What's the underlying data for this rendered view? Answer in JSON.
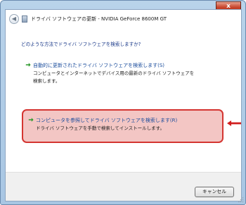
{
  "window": {
    "title": "ドライバ ソフトウェアの更新 - NVIDIA GeForce 8600M GT",
    "close_label": "x"
  },
  "main": {
    "question": "どのような方法でドライバ ソフトウェアを検索しますか?",
    "options": [
      {
        "title": "自動的に更新されたドライバ ソフトウェアを検索します(S)",
        "desc_lines": [
          "コンピュータとインターネットでデバイス用の最新のドライバ ソフトウェアを",
          "検索します。"
        ]
      },
      {
        "title": "コンピュータを参照してドライバ ソフトウェアを検索します(R)",
        "desc_lines": [
          "ドライバ ソフトウェアを手動で検索してインストールします。"
        ],
        "highlighted": true
      }
    ]
  },
  "footer": {
    "cancel_label": "キャンセル"
  },
  "icons": {
    "back": "back-arrow-icon",
    "app": "driver-icon",
    "option_arrow": "green-arrow-icon",
    "annotation": "red-arrow-icon"
  },
  "colors": {
    "link": "#1a4c9c",
    "option_arrow": "#2e9a2e",
    "highlight_border": "#d43531",
    "highlight_fill": "#f3c6c4",
    "annotation_arrow": "#d11f1f"
  }
}
